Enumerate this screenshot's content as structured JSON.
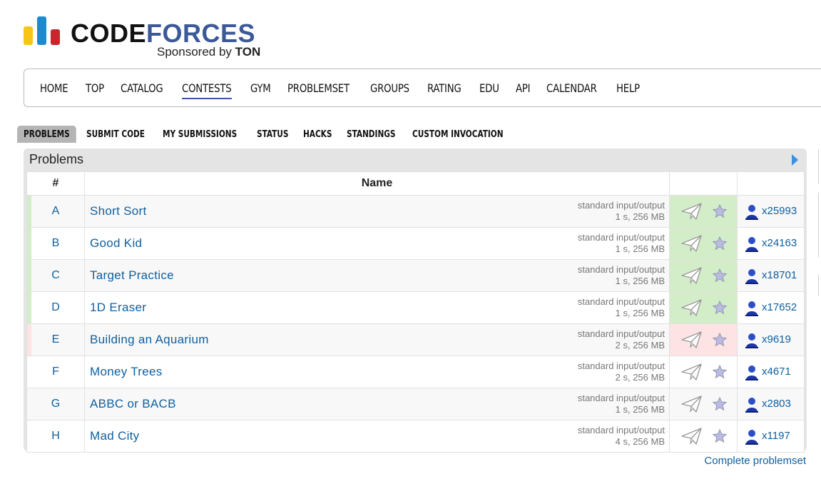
{
  "logo": {
    "word_part1": "CODE",
    "word_part2": "FORCES",
    "sponsor_prefix": "Sponsored by ",
    "sponsor_name": "TON"
  },
  "main_nav": [
    "HOME",
    "TOP",
    "CATALOG",
    "CONTESTS",
    "GYM",
    "PROBLEMSET",
    "GROUPS",
    "RATING",
    "EDU",
    "API",
    "CALENDAR",
    "HELP"
  ],
  "main_nav_active": "CONTESTS",
  "second_nav": [
    "PROBLEMS",
    "SUBMIT CODE",
    "MY SUBMISSIONS",
    "STATUS",
    "HACKS",
    "STANDINGS",
    "CUSTOM INVOCATION"
  ],
  "second_nav_active": "PROBLEMS",
  "problems": {
    "title": "Problems",
    "headers": {
      "id": "#",
      "name": "Name"
    },
    "rows": [
      {
        "id": "A",
        "name": "Short Sort",
        "io": "standard input/output",
        "limits": "1 s, 256 MB",
        "status": "ok",
        "solved": "x25993"
      },
      {
        "id": "B",
        "name": "Good Kid",
        "io": "standard input/output",
        "limits": "1 s, 256 MB",
        "status": "ok",
        "solved": "x24163"
      },
      {
        "id": "C",
        "name": "Target Practice",
        "io": "standard input/output",
        "limits": "1 s, 256 MB",
        "status": "ok",
        "solved": "x18701"
      },
      {
        "id": "D",
        "name": "1D Eraser",
        "io": "standard input/output",
        "limits": "1 s, 256 MB",
        "status": "ok",
        "solved": "x17652"
      },
      {
        "id": "E",
        "name": "Building an Aquarium",
        "io": "standard input/output",
        "limits": "2 s, 256 MB",
        "status": "bad",
        "solved": "x9619"
      },
      {
        "id": "F",
        "name": "Money Trees",
        "io": "standard input/output",
        "limits": "2 s, 256 MB",
        "status": "none",
        "solved": "x4671"
      },
      {
        "id": "G",
        "name": "ABBC or BACB",
        "io": "standard input/output",
        "limits": "1 s, 256 MB",
        "status": "none",
        "solved": "x2803"
      },
      {
        "id": "H",
        "name": "Mad City",
        "io": "standard input/output",
        "limits": "4 s, 256 MB",
        "status": "none",
        "solved": "x1197"
      }
    ],
    "complete_link": "Complete problemset"
  },
  "colors": {
    "link": "#10609f",
    "accent": "#3b5998",
    "accepted": "#d4edc9",
    "rejected": "#fde3e3"
  },
  "icons": {
    "submit": "paper-plane-icon",
    "favourite": "star-icon",
    "solved_by": "user-icon"
  }
}
